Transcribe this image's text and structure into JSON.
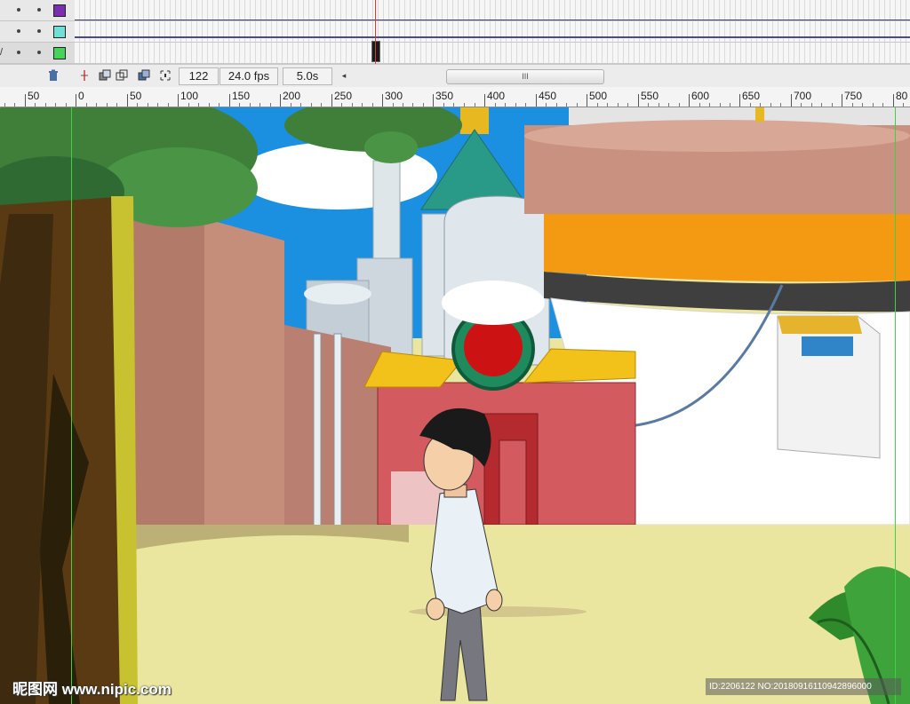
{
  "timeline": {
    "layers": [
      {
        "color": "#7a2fb0",
        "selected": false
      },
      {
        "color": "#6fe0d6",
        "selected": false
      },
      {
        "color": "#46d35a",
        "selected": true
      }
    ],
    "current_frame": "122",
    "frame_rate": "24.0 fps",
    "elapsed_time": "5.0s",
    "icons": {
      "delete": "trash-icon",
      "center_frame": "center-frame-icon",
      "onion_skin": "onion-skin-icon",
      "onion_outlines": "onion-skin-outlines-icon",
      "edit_multiple": "edit-multiple-frames-icon",
      "modify_markers": "modify-onion-markers-icon",
      "scroll_left": "scroll-left-icon",
      "scroll_grip": "scroll-grip-icon"
    },
    "scroll_grip": "III"
  },
  "ruler": {
    "labels": [
      "50",
      "0",
      "50",
      "100",
      "150",
      "200",
      "250",
      "300",
      "350",
      "400",
      "450",
      "500",
      "550",
      "600",
      "650",
      "700",
      "750",
      "80"
    ]
  },
  "stage": {
    "guide_color": "#3fd046",
    "scene": [
      "tree",
      "sky",
      "clouds",
      "white-tower",
      "pipes",
      "palace-gate",
      "round-building",
      "walking-man",
      "plant"
    ]
  },
  "watermark": {
    "site": "昵图网 www.nipic.com",
    "id": "ID:2206122 NO:20180916110942896000"
  }
}
